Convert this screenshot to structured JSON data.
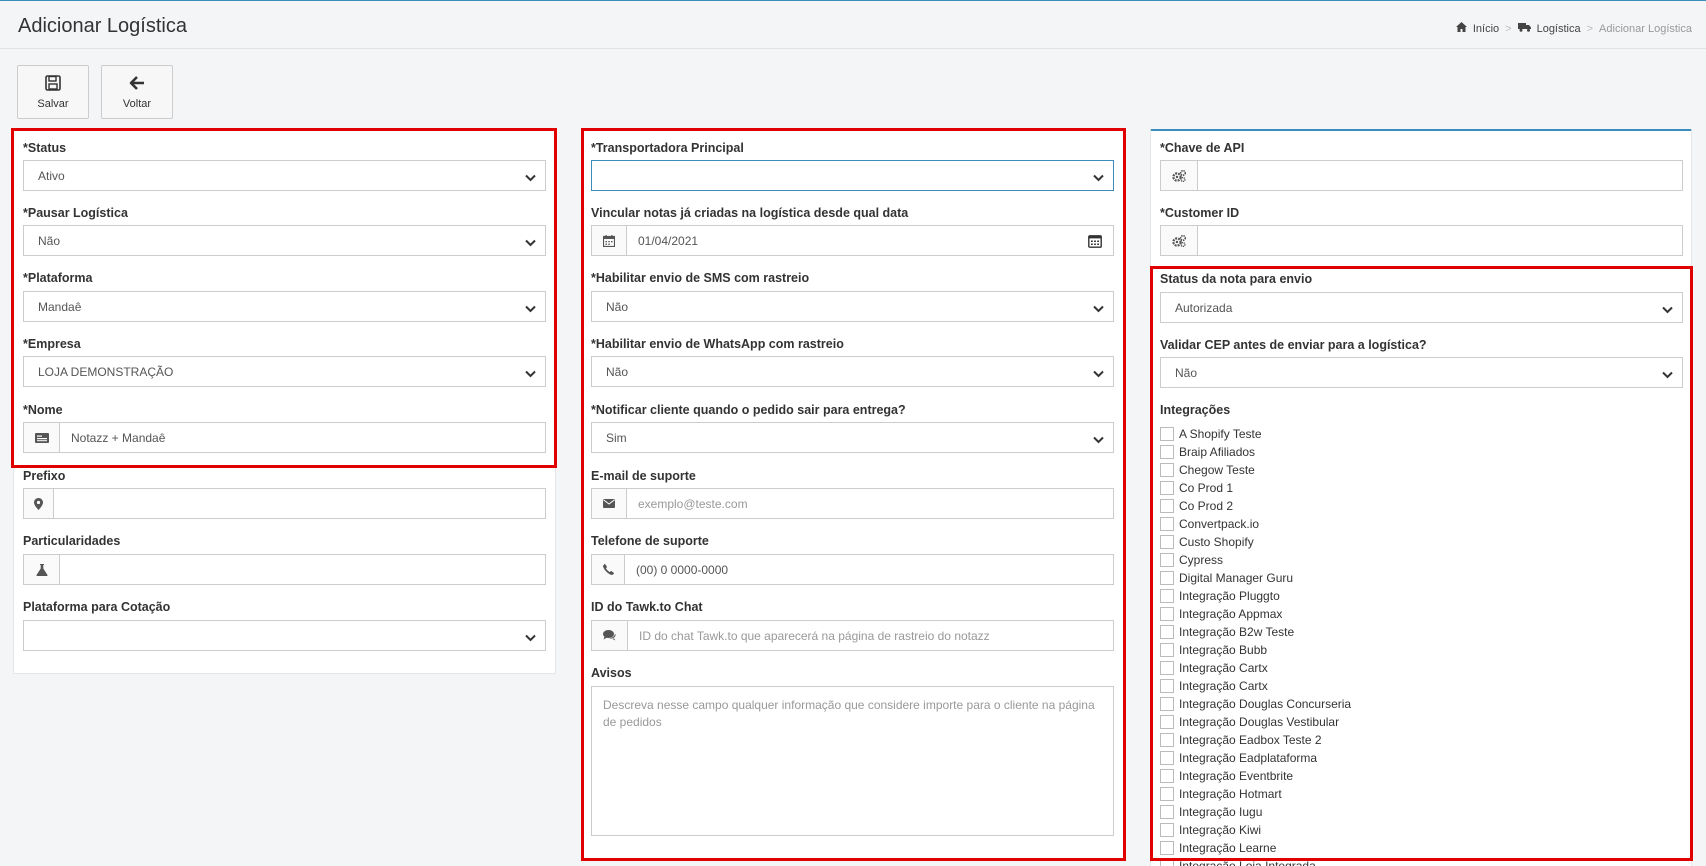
{
  "header": {
    "title": "Adicionar Logística",
    "breadcrumb": {
      "home": "Início",
      "parent": "Logística",
      "current": "Adicionar Logística",
      "separator": ">"
    }
  },
  "toolbar": {
    "save_label": "Salvar",
    "back_label": "Voltar"
  },
  "left": {
    "status": {
      "label": "*Status",
      "value": "Ativo"
    },
    "pausar": {
      "label": "*Pausar Logística",
      "value": "Não"
    },
    "plataforma": {
      "label": "*Plataforma",
      "value": "Mandaê"
    },
    "empresa": {
      "label": "*Empresa",
      "value": "LOJA DEMONSTRAÇÃO"
    },
    "nome": {
      "label": "*Nome",
      "value": "Notazz + Mandaê"
    },
    "prefixo": {
      "label": "Prefixo",
      "value": ""
    },
    "particularidades": {
      "label": "Particularidades",
      "value": ""
    },
    "plataforma_cotacao": {
      "label": "Plataforma para Cotação",
      "value": ""
    }
  },
  "middle": {
    "transportadora": {
      "label": "*Transportadora Principal",
      "value": ""
    },
    "vincular": {
      "label": "Vincular notas já criadas na logística desde qual data",
      "value": "01/04/2021"
    },
    "sms": {
      "label": "*Habilitar envio de SMS com rastreio",
      "value": "Não"
    },
    "whatsapp": {
      "label": "*Habilitar envio de WhatsApp com rastreio",
      "value": "Não"
    },
    "notificar": {
      "label": "*Notificar cliente quando o pedido sair para entrega?",
      "value": "Sim"
    },
    "email": {
      "label": "E-mail de suporte",
      "placeholder": "exemplo@teste.com"
    },
    "telefone": {
      "label": "Telefone de suporte",
      "placeholder": "(00) 0 0000-0000"
    },
    "tawk": {
      "label": "ID do Tawk.to Chat",
      "placeholder": "ID do chat Tawk.to que aparecerá na página de rastreio do notazz"
    },
    "avisos": {
      "label": "Avisos",
      "placeholder": "Descreva nesse campo qualquer informação que considere importe para o cliente na página de pedidos"
    }
  },
  "right": {
    "api": {
      "label": "*Chave de API",
      "value": ""
    },
    "customer": {
      "label": "*Customer ID",
      "value": ""
    },
    "status_nota": {
      "label": "Status da nota para envio",
      "value": "Autorizada"
    },
    "validar_cep": {
      "label": "Validar CEP antes de enviar para a logística?",
      "value": "Não"
    },
    "integracoes_label": "Integrações",
    "integracoes": [
      "A Shopify Teste",
      "Braip Afiliados",
      "Chegow Teste",
      "Co Prod 1",
      "Co Prod 2",
      "Convertpack.io",
      "Custo Shopify",
      "Cypress",
      "Digital Manager Guru",
      "Integração Pluggto",
      "Integração Appmax",
      "Integração B2w Teste",
      "Integração Bubb",
      "Integração Cartx",
      "Integração Cartx",
      "Integração Douglas Concurseria",
      "Integração Douglas Vestibular",
      "Integração Eadbox Teste 2",
      "Integração Eadplataforma",
      "Integração Eventbrite",
      "Integração Hotmart",
      "Integração Iugu",
      "Integração Kiwi",
      "Integração Learne",
      "Integração Loja Integrada"
    ]
  },
  "colors": {
    "highlight_border": "#e00000",
    "accent": "#3c8dbc"
  },
  "icons": {
    "home": "home-icon",
    "truck": "truck-icon",
    "save": "floppy-disk-icon",
    "back": "arrow-left-icon",
    "id_card": "id-card-icon",
    "map_marker": "map-marker-icon",
    "flask": "flask-icon",
    "calendar": "calendar-icon",
    "envelope": "envelope-icon",
    "phone": "phone-icon",
    "comments": "comments-icon",
    "cogs": "cogs-icon",
    "chevron": "chevron-down-icon"
  }
}
